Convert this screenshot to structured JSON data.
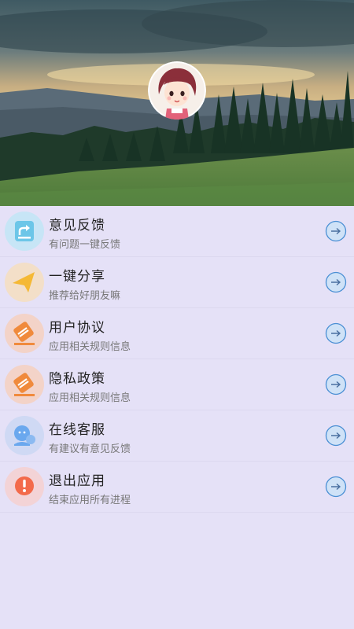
{
  "header": {
    "background": "landscape-photo",
    "avatar": "avatar-girl"
  },
  "menu": {
    "items": [
      {
        "title": "意见反馈",
        "subtitle": "有问题一键反馈",
        "icon": "share-box-icon",
        "color": "#6cc6e8"
      },
      {
        "title": "一键分享",
        "subtitle": "推荐给好朋友嘛",
        "icon": "paper-plane-icon",
        "color": "#f5b935"
      },
      {
        "title": "用户协议",
        "subtitle": "应用相关规则信息",
        "icon": "agreement-tag-icon",
        "color": "#f08a3c"
      },
      {
        "title": "隐私政策",
        "subtitle": "应用相关规则信息",
        "icon": "privacy-tag-icon",
        "color": "#f08a3c"
      },
      {
        "title": "在线客服",
        "subtitle": "有建议有意见反馈",
        "icon": "customer-service-icon",
        "color": "#6aa8ee"
      },
      {
        "title": "退出应用",
        "subtitle": "结束应用所有进程",
        "icon": "exit-alert-icon",
        "color": "#f36a4a"
      }
    ]
  },
  "colors": {
    "background": "#e5e1f7",
    "arrow_button": "#4a8fd4"
  }
}
